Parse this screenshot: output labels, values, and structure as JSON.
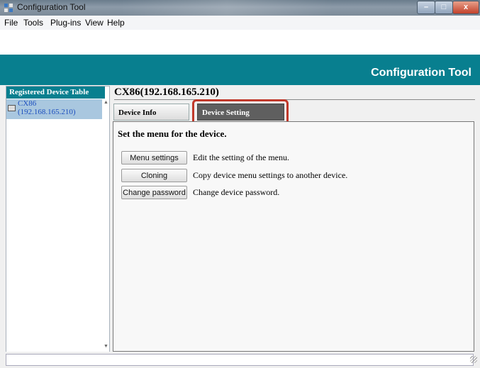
{
  "window": {
    "title": "Configuration Tool"
  },
  "menu": [
    "File",
    "Tools",
    "Plug-ins",
    "View",
    "Help"
  ],
  "banner": {
    "title": "Configuration Tool"
  },
  "left_panel": {
    "header": "Registered Device Table",
    "device": {
      "name": "CX86",
      "address": "(192.168.165.210)"
    }
  },
  "device_header": "CX86(192.168.165.210)",
  "tabs": {
    "info": "Device Info",
    "setting": "Device Setting"
  },
  "content": {
    "heading": "Set the menu for the device.",
    "rows": [
      {
        "button": "Menu settings",
        "description": "Edit the setting of the menu."
      },
      {
        "button": "Cloning",
        "description": "Copy device menu settings to another device."
      },
      {
        "button": "Change password",
        "description": "Change device password."
      }
    ]
  },
  "colors": {
    "banner": "#087f8f",
    "selected_tab": "#5f5f5f",
    "highlight": "#c0392b",
    "selection": "#a9c7df"
  },
  "icons": [
    "app-icon",
    "minimize-icon",
    "maximize-icon",
    "close-icon",
    "device-icon",
    "scroll-up-icon",
    "scroll-down-icon",
    "resize-grip-icon"
  ]
}
